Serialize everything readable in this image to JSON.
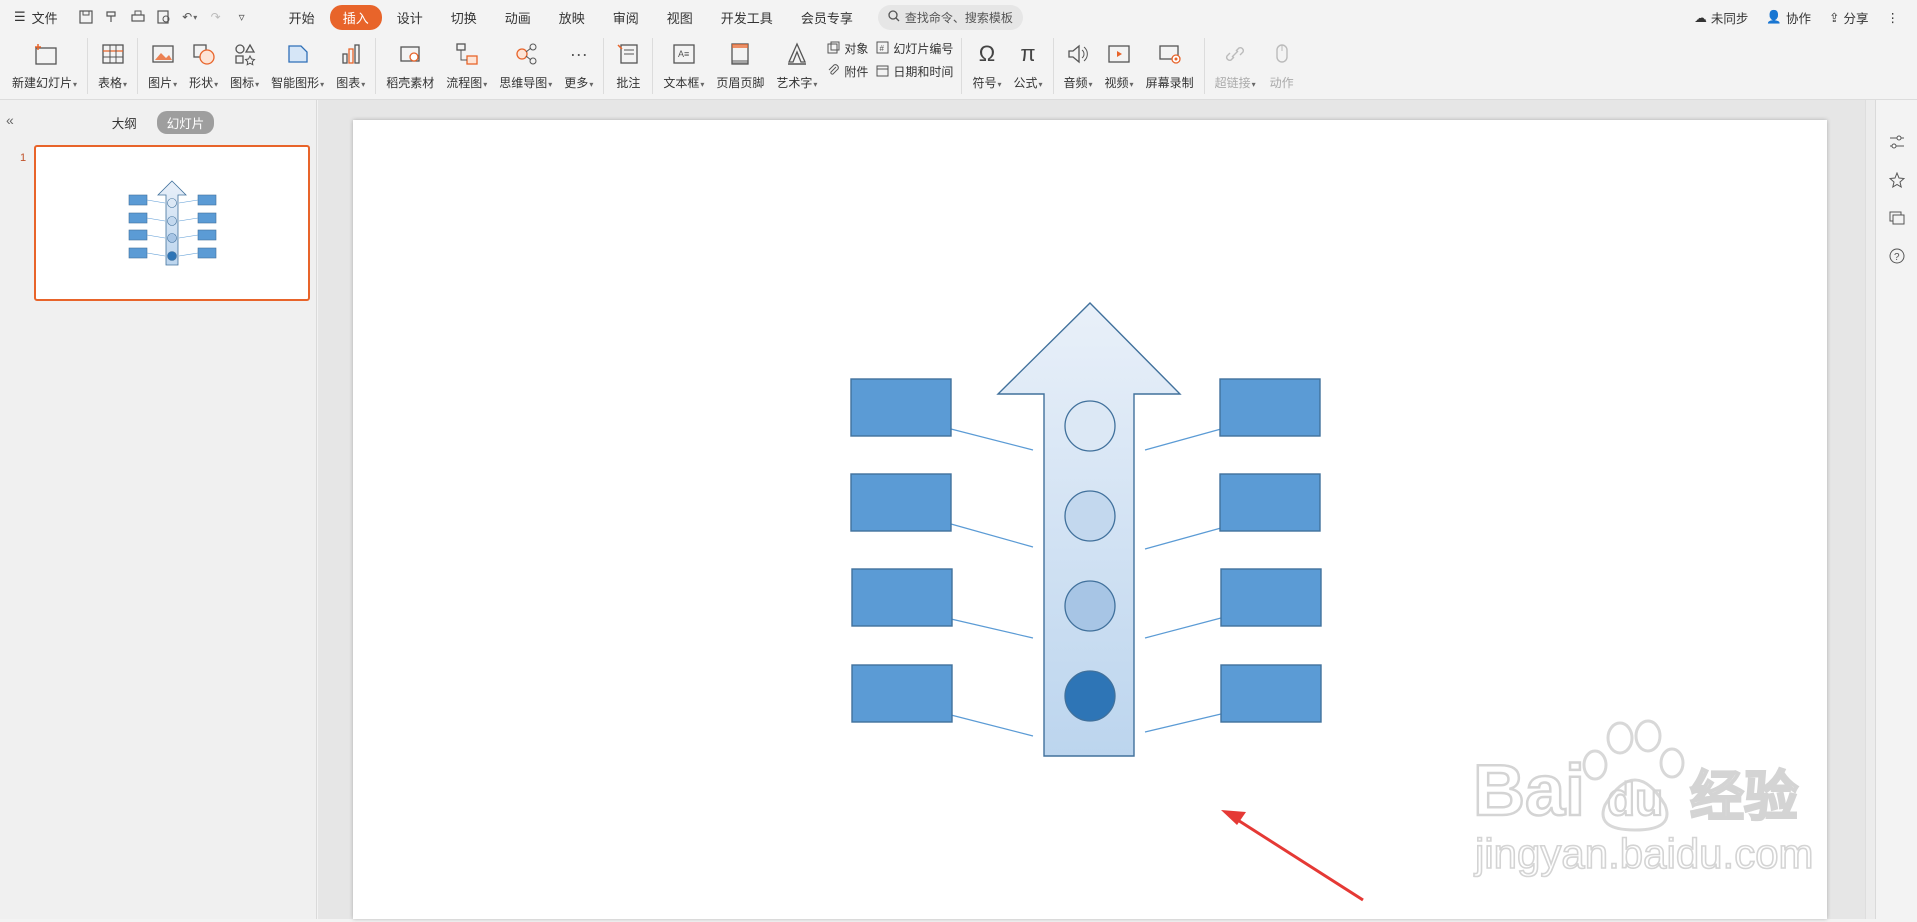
{
  "menubar": {
    "file_label": "文件",
    "tabs": [
      "开始",
      "插入",
      "设计",
      "切换",
      "动画",
      "放映",
      "审阅",
      "视图",
      "开发工具",
      "会员专享"
    ],
    "active_tab": "插入",
    "search_placeholder": "查找命令、搜索模板",
    "sync_label": "未同步",
    "collab_label": "协作",
    "share_label": "分享"
  },
  "ribbon": {
    "new_slide": "新建幻灯片",
    "table": "表格",
    "picture": "图片",
    "shape": "形状",
    "icon": "图标",
    "smartart": "智能图形",
    "chart": "图表",
    "material": "稻壳素材",
    "flowchart": "流程图",
    "mindmap": "思维导图",
    "more": "更多",
    "comment": "批注",
    "textbox": "文本框",
    "header_footer": "页眉页脚",
    "wordart": "艺术字",
    "object": "对象",
    "attachment": "附件",
    "slide_number": "幻灯片编号",
    "date_time": "日期和时间",
    "symbol": "符号",
    "formula": "公式",
    "audio": "音频",
    "video": "视频",
    "screen_record": "屏幕录制",
    "hyperlink": "超链接",
    "action": "动作"
  },
  "left_panel": {
    "outline_tab": "大纲",
    "slides_tab": "幻灯片",
    "slide_number": "1"
  },
  "slide": {
    "box_color": "#5b9bd5",
    "box_border": "#41719c",
    "arrow_gradient_top": "#e9f0f9",
    "arrow_gradient_bottom": "#bcd5ee",
    "circle_fills": [
      "#dce8f5",
      "#c3d8ee",
      "#a7c5e5",
      "#2e75b6"
    ]
  },
  "watermark": {
    "brand": "Bai",
    "brand2": "du",
    "cn": "经验",
    "url": "jingyan.baidu.com"
  },
  "annotation": {
    "arrow_color": "#e53935"
  }
}
